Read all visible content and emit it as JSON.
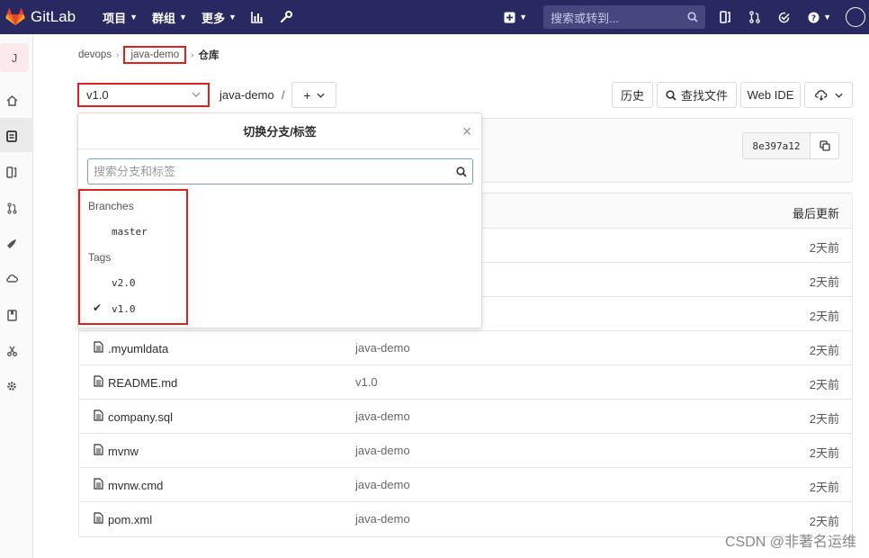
{
  "brand": {
    "name": "GitLab"
  },
  "topnav": [
    {
      "label": "项目"
    },
    {
      "label": "群组"
    },
    {
      "label": "更多"
    }
  ],
  "search": {
    "placeholder": "搜索或转到..."
  },
  "sidebar": {
    "project_initial": "J"
  },
  "breadcrumb": {
    "group": "devops",
    "project": "java-demo",
    "current": "仓库"
  },
  "ref": {
    "selected": "v1.0"
  },
  "repo": {
    "name": "java-demo",
    "separator": "/"
  },
  "buttons": {
    "history": "历史",
    "find_file": "查找文件",
    "web_ide": "Web IDE"
  },
  "commit": {
    "sha": "8e397a12"
  },
  "table": {
    "last_update_header": "最后更新",
    "rows": [
      {
        "name": "",
        "commit": "",
        "time": "2天前"
      },
      {
        "name": "",
        "commit": "",
        "time": "2天前"
      },
      {
        "name": "",
        "commit": "",
        "time": "2天前"
      },
      {
        "name": ".myumldata",
        "commit": "java-demo",
        "time": "2天前"
      },
      {
        "name": "README.md",
        "commit": "v1.0",
        "time": "2天前"
      },
      {
        "name": "company.sql",
        "commit": "java-demo",
        "time": "2天前"
      },
      {
        "name": "mvnw",
        "commit": "java-demo",
        "time": "2天前"
      },
      {
        "name": "mvnw.cmd",
        "commit": "java-demo",
        "time": "2天前"
      },
      {
        "name": "pom.xml",
        "commit": "java-demo",
        "time": "2天前"
      }
    ]
  },
  "dropdown": {
    "title": "切换分支/标签",
    "search_placeholder": "搜索分支和标签",
    "branches_header": "Branches",
    "branches": [
      "master"
    ],
    "tags_header": "Tags",
    "tags": [
      "v2.0",
      "v1.0"
    ],
    "selected_tag": "v1.0"
  },
  "watermark": "CSDN @非著名运维",
  "colors": {
    "navbar": "#292961",
    "highlight": "#e02020",
    "brand_orange": "#fc6d26"
  }
}
